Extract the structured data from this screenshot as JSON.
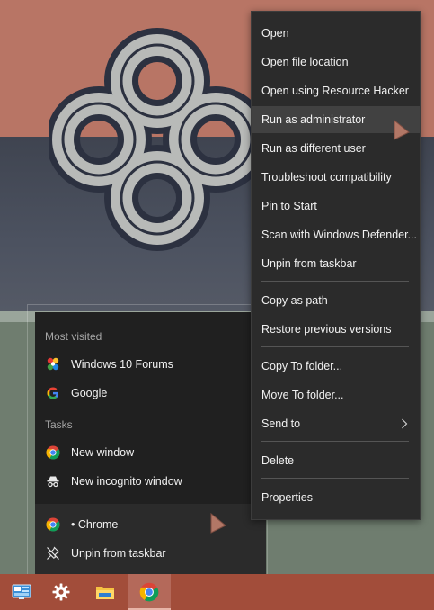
{
  "jumplist": {
    "most_visited_heading": "Most visited",
    "most_visited": [
      {
        "label": "Windows 10 Forums",
        "icon": "windows10forums-icon"
      },
      {
        "label": "Google",
        "icon": "google-g-icon"
      }
    ],
    "tasks_heading": "Tasks",
    "tasks": [
      {
        "label": "New window",
        "icon": "chrome-icon"
      },
      {
        "label": "New incognito window",
        "icon": "incognito-icon"
      }
    ],
    "app_item": {
      "label": "• Chrome",
      "icon": "chrome-icon"
    },
    "unpin_item": {
      "label": "Unpin from taskbar",
      "icon": "unpin-icon"
    }
  },
  "context_menu": {
    "items": [
      {
        "label": "Open"
      },
      {
        "label": "Open file location"
      },
      {
        "label": "Open using Resource Hacker"
      },
      {
        "label": "Run as administrator",
        "highlighted": true
      },
      {
        "label": "Run as different user"
      },
      {
        "label": "Troubleshoot compatibility"
      },
      {
        "label": "Pin to Start"
      },
      {
        "label": "Scan with Windows Defender..."
      },
      {
        "label": "Unpin from taskbar"
      },
      {
        "label": "Copy as path"
      },
      {
        "label": "Restore previous versions"
      },
      {
        "label": "Copy To folder..."
      },
      {
        "label": "Move To folder..."
      },
      {
        "label": "Send to",
        "has_submenu": true
      },
      {
        "label": "Delete"
      },
      {
        "label": "Properties"
      }
    ]
  },
  "taskbar": {
    "items": [
      {
        "name": "control-panel-icon"
      },
      {
        "name": "settings-gear-icon"
      },
      {
        "name": "file-explorer-icon"
      },
      {
        "name": "chrome-icon",
        "active": true
      }
    ]
  },
  "colors": {
    "menu_bg": "#2b2b2b",
    "menu_hover": "#414141",
    "jumplist_bg": "#202020",
    "taskbar": "#a24d3a",
    "text": "#f2f2f2",
    "heading_text": "#a7a7a7"
  }
}
